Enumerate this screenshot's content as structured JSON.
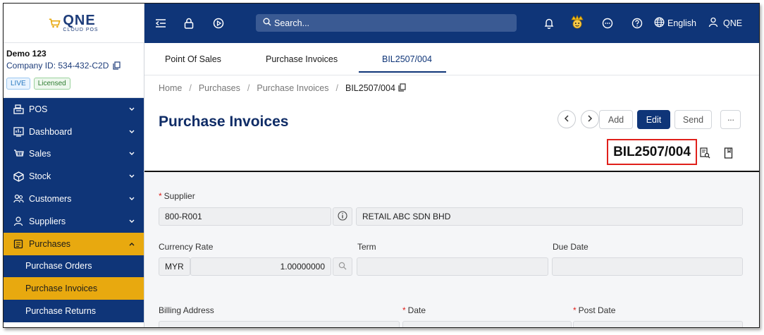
{
  "app": {
    "logo_text": "QNE",
    "logo_subtext": "CLOUD POS"
  },
  "company": {
    "name": "Demo 123",
    "id_label": "Company ID: 534-432-C2D",
    "badge_live": "LIVE",
    "badge_licensed": "Licensed"
  },
  "sidebar": {
    "items": [
      {
        "label": "POS",
        "icon": "register-icon"
      },
      {
        "label": "Dashboard",
        "icon": "dashboard-icon"
      },
      {
        "label": "Sales",
        "icon": "cart-icon"
      },
      {
        "label": "Stock",
        "icon": "box-icon"
      },
      {
        "label": "Customers",
        "icon": "customers-icon"
      },
      {
        "label": "Suppliers",
        "icon": "supplier-icon"
      },
      {
        "label": "Purchases",
        "icon": "purchases-icon"
      }
    ],
    "sub_items": [
      {
        "label": "Purchase Orders"
      },
      {
        "label": "Purchase Invoices"
      },
      {
        "label": "Purchase Returns"
      }
    ]
  },
  "topbar": {
    "search_placeholder": "Search...",
    "language": "English",
    "user": "QNE"
  },
  "tabs": [
    {
      "label": "Point Of Sales"
    },
    {
      "label": "Purchase Invoices"
    },
    {
      "label": "BIL2507/004"
    }
  ],
  "breadcrumb": {
    "home": "Home",
    "purchases": "Purchases",
    "invoices": "Purchase Invoices",
    "current": "BIL2507/004"
  },
  "page": {
    "title": "Purchase Invoices",
    "doc_no": "BIL2507/004",
    "add_label": "Add",
    "edit_label": "Edit",
    "send_label": "Send",
    "more_label": "···"
  },
  "form": {
    "supplier_label": "Supplier",
    "supplier_code": "800-R001",
    "supplier_name": "RETAIL ABC SDN BHD",
    "currency_rate_label": "Currency Rate",
    "currency": "MYR",
    "rate": "1.00000000",
    "term_label": "Term",
    "term_value": "",
    "due_date_label": "Due Date",
    "due_date_value": "",
    "billing_address_label": "Billing Address",
    "date_label": "Date",
    "post_date_label": "Post Date"
  },
  "colors": {
    "navy": "#0f3578",
    "accent": "#e8a90f",
    "highlight": "#e0201b"
  }
}
